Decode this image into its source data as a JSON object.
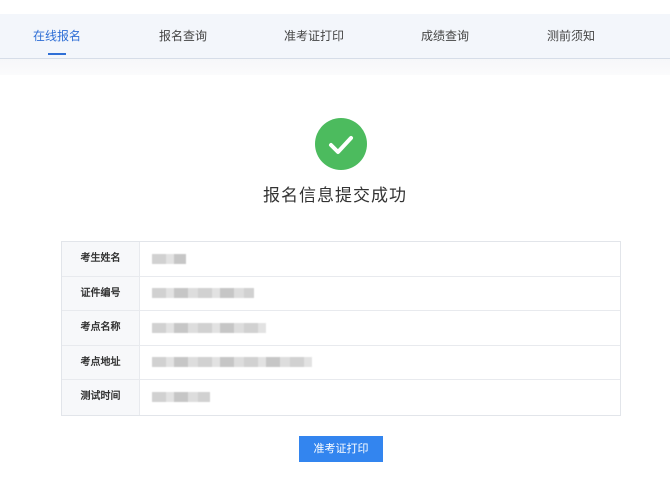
{
  "nav": {
    "tabs": [
      {
        "label": "在线报名",
        "active": true
      },
      {
        "label": "报名查询",
        "active": false
      },
      {
        "label": "准考证打印",
        "active": false
      },
      {
        "label": "成绩查询",
        "active": false
      },
      {
        "label": "测前须知",
        "active": false
      }
    ],
    "accent_color": "#2f6fd6"
  },
  "result": {
    "icon": "check-circle-icon",
    "icon_color": "#4cbb5e",
    "title": "报名信息提交成功"
  },
  "info": {
    "rows": [
      {
        "label": "考生姓名"
      },
      {
        "label": "证件编号"
      },
      {
        "label": "考点名称"
      },
      {
        "label": "考点地址"
      },
      {
        "label": "测试时间"
      }
    ]
  },
  "actions": {
    "print_label": "准考证打印",
    "button_color": "#3385ef"
  }
}
